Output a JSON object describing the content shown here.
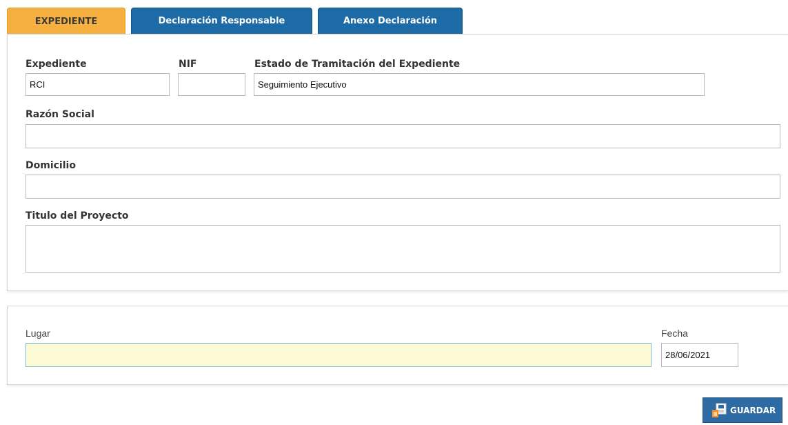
{
  "tabs": [
    {
      "label": "EXPEDIENTE",
      "active": true
    },
    {
      "label": "Declaración Responsable",
      "active": false
    },
    {
      "label": "Anexo Declaración",
      "active": false
    }
  ],
  "expediente": {
    "expediente_label": "Expediente",
    "expediente_value": "RCI",
    "nif_label": "NIF",
    "nif_value": "",
    "estado_label": "Estado de Tramitación del Expediente",
    "estado_value": "Seguimiento Ejecutivo",
    "razon_label": "Razón Social",
    "razon_value": "",
    "domicilio_label": "Domicilio",
    "domicilio_value": "",
    "titulo_label": "Titulo del Proyecto",
    "titulo_value": ""
  },
  "firma": {
    "lugar_label": "Lugar",
    "lugar_value": "",
    "fecha_label": "Fecha",
    "fecha_value": "28/06/2021"
  },
  "actions": {
    "save_label": "GUARDAR",
    "save_icon": "save-icon"
  },
  "colors": {
    "tab_active": "#f6b040",
    "tab_inactive": "#1c6aa6",
    "lugar_bg": "#fdfbd6",
    "save_button": "#2e6aa3"
  }
}
